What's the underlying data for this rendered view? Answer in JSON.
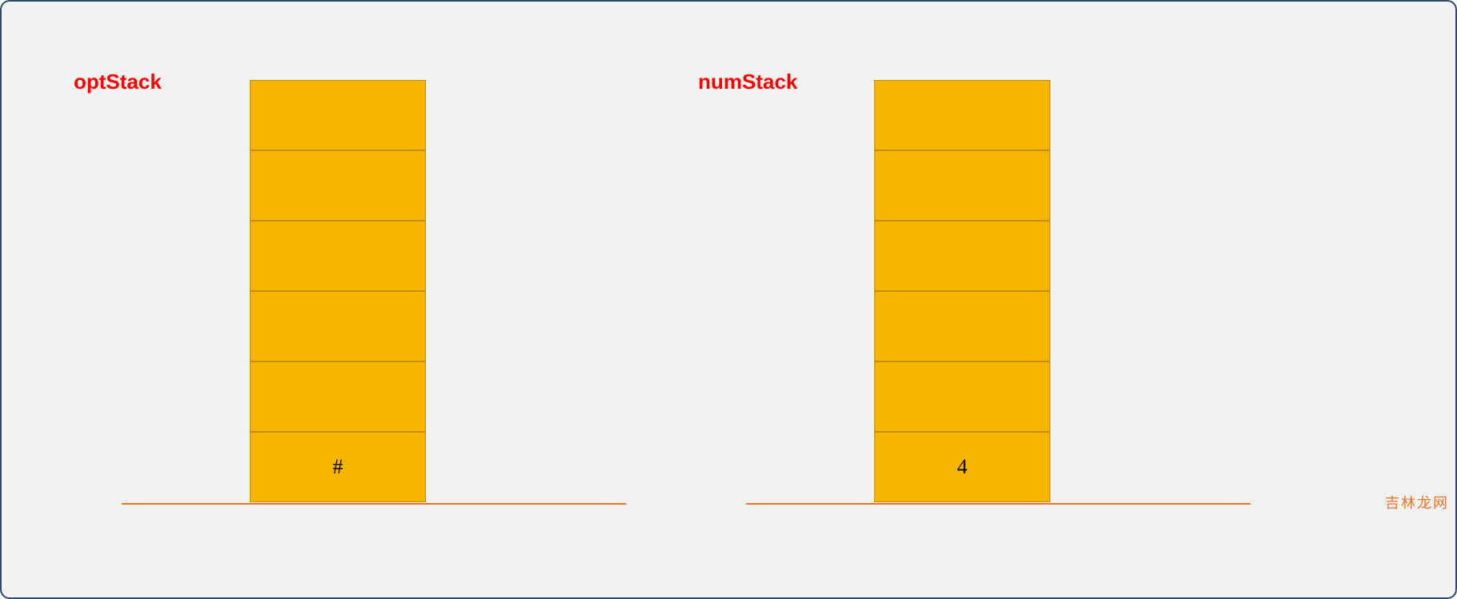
{
  "chart_data": {
    "type": "table",
    "title": "",
    "stacks": [
      {
        "name": "optStack",
        "cells_top_to_bottom": [
          "",
          "",
          "",
          "",
          "",
          "#"
        ]
      },
      {
        "name": "numStack",
        "cells_top_to_bottom": [
          "",
          "",
          "",
          "",
          "",
          "4"
        ]
      }
    ]
  },
  "left": {
    "label": "optStack",
    "cells": {
      "c0": "",
      "c1": "",
      "c2": "",
      "c3": "",
      "c4": "",
      "c5": "#"
    }
  },
  "right": {
    "label": "numStack",
    "cells": {
      "c0": "",
      "c1": "",
      "c2": "",
      "c3": "",
      "c4": "",
      "c5": "4"
    }
  },
  "watermark": "吉林龙网"
}
